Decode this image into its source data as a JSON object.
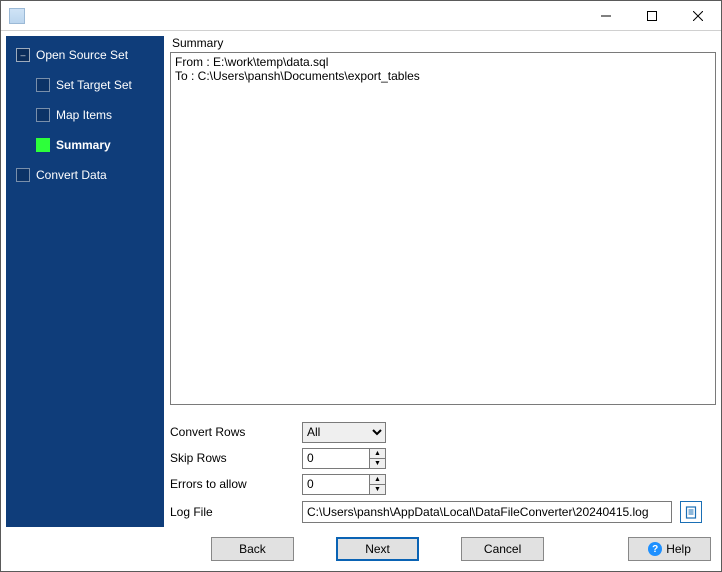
{
  "window": {
    "title": ""
  },
  "sidebar": {
    "items": [
      {
        "label": "Open Source Set",
        "level": 0,
        "current": false
      },
      {
        "label": "Set Target Set",
        "level": 1,
        "current": false
      },
      {
        "label": "Map Items",
        "level": 1,
        "current": false
      },
      {
        "label": "Summary",
        "level": 1,
        "current": true
      },
      {
        "label": "Convert Data",
        "level": 0,
        "current": false
      }
    ]
  },
  "main": {
    "group_label": "Summary",
    "summary_text": "From : E:\\work\\temp\\data.sql\nTo : C:\\Users\\pansh\\Documents\\export_tables"
  },
  "options": {
    "convert_rows": {
      "label": "Convert Rows",
      "value": "All",
      "choices": [
        "All"
      ]
    },
    "skip_rows": {
      "label": "Skip Rows",
      "value": "0"
    },
    "errors": {
      "label": "Errors to allow",
      "value": "0"
    },
    "log_file": {
      "label": "Log File",
      "value": "C:\\Users\\pansh\\AppData\\Local\\DataFileConverter\\20240415.log"
    }
  },
  "footer": {
    "back": "Back",
    "next": "Next",
    "cancel": "Cancel",
    "help": "Help"
  }
}
